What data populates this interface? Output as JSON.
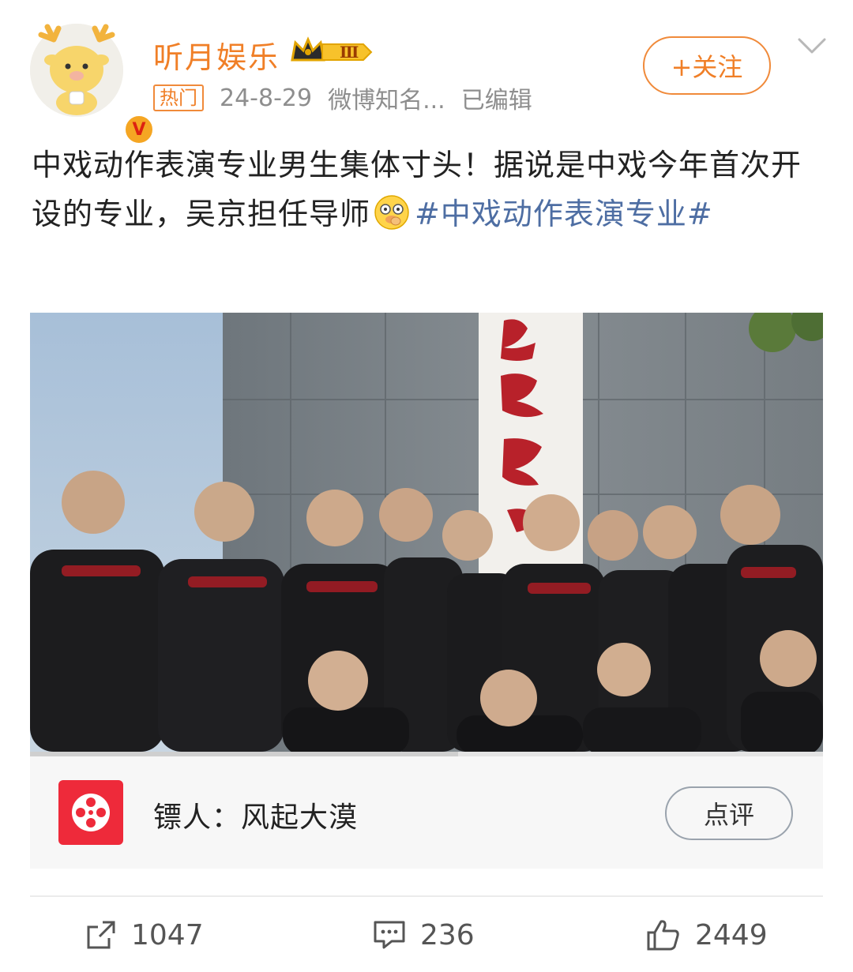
{
  "header": {
    "username": "听月娱乐",
    "level_badge": "Ⅲ",
    "hot_tag": "热门",
    "date": "24-8-29",
    "source": "微博知名...",
    "edited": "已编辑",
    "follow_label": "+关注",
    "verified_badge": "V"
  },
  "post": {
    "text": "中戏动作表演专业男生集体寸头！据说是中戏今年首次开设的专业，吴京担任导师",
    "emoji": "wink-emoji",
    "topic": "#中戏动作表演专业#"
  },
  "video": {
    "progress": 0.54
  },
  "movie_card": {
    "title": "镖人：风起大漠",
    "review_label": "点评"
  },
  "actions": {
    "repost_count": "1047",
    "comment_count": "236",
    "like_count": "2449"
  },
  "colors": {
    "accent": "#f07f27",
    "topic": "#4e6ea3",
    "movie_icon": "#ee2a3a"
  }
}
